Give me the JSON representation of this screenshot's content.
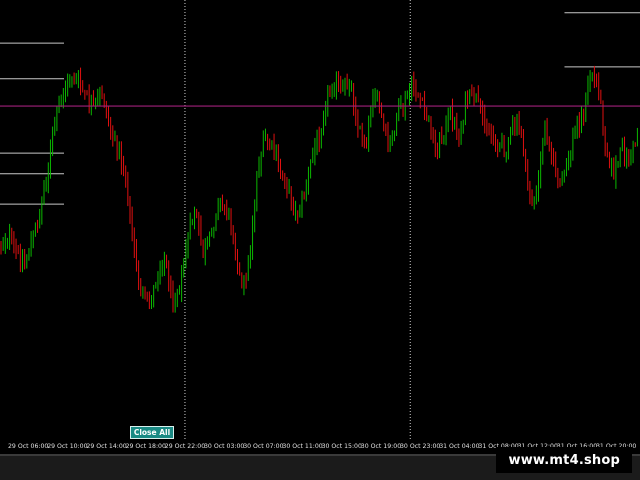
{
  "close_all_label": "Close All",
  "watermark": "www.mt4.shop",
  "time_axis": {
    "labels": [
      "29 Oct 06:00",
      "29 Oct 10:00",
      "29 Oct 14:00",
      "29 Oct 18:00",
      "29 Oct 22:00",
      "30 Oct 03:00",
      "30 Oct 07:00",
      "30 Oct 11:00",
      "30 Oct 15:00",
      "30 Oct 19:00",
      "30 Oct 23:00",
      "31 Oct 04:00",
      "31 Oct 08:00",
      "31 Oct 12:00",
      "31 Oct 16:00",
      "31 Oct 20:00"
    ]
  },
  "colors": {
    "bull": "#0bb800",
    "bear": "#e01010",
    "level_line": "#c8c8c8",
    "current_line": "#a0207a",
    "separator": "#cfcfcf"
  },
  "chart_data": {
    "type": "candlestick",
    "x": "bar index (time axis labels shown below chart)",
    "y_profile": [
      245,
      235,
      252,
      262,
      240,
      215,
      170,
      120,
      95,
      75,
      82,
      98,
      108,
      92,
      125,
      150,
      175,
      245,
      290,
      305,
      282,
      255,
      300,
      285,
      240,
      210,
      255,
      240,
      200,
      210,
      235,
      290,
      260,
      170,
      135,
      150,
      170,
      190,
      215,
      195,
      160,
      135,
      95,
      82,
      92,
      80,
      128,
      140,
      88,
      118,
      150,
      118,
      105,
      85,
      100,
      120,
      150,
      135,
      110,
      140,
      100,
      95,
      115,
      130,
      145,
      150,
      125,
      130,
      195,
      200,
      125,
      155,
      190,
      165,
      128,
      115,
      70,
      88,
      150,
      175,
      150,
      160,
      135
    ],
    "price_levels": [
      {
        "y_frac": 0.098,
        "x_to": 0.1
      },
      {
        "y_frac": 0.179,
        "x_to": 0.1
      },
      {
        "y_frac": 0.348,
        "x_to": 0.1
      },
      {
        "y_frac": 0.395,
        "x_to": 0.1
      },
      {
        "y_frac": 0.464,
        "x_to": 0.1
      },
      {
        "y_frac": 0.029,
        "x_from": 0.882
      },
      {
        "y_frac": 0.152,
        "x_from": 0.882
      }
    ],
    "current_price_frac": 0.241,
    "period_separators_x_frac": [
      0.289,
      0.641
    ]
  }
}
